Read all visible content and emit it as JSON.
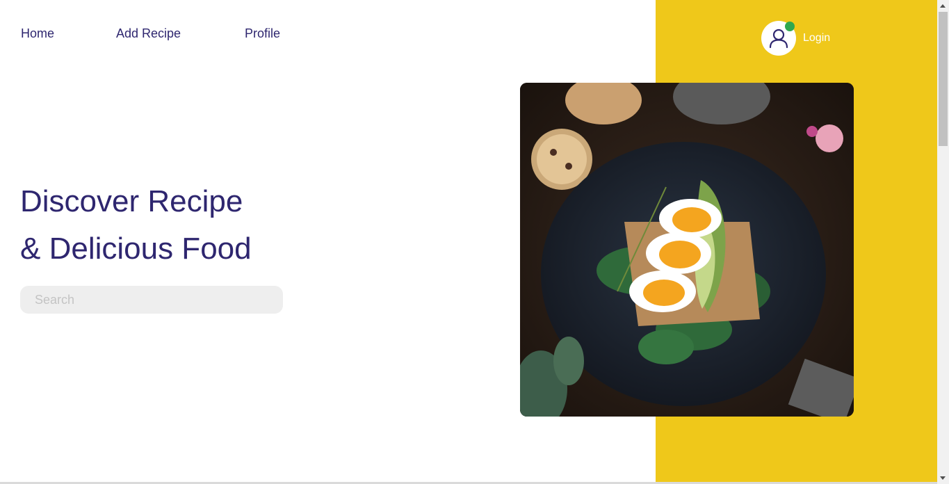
{
  "nav": {
    "items": [
      {
        "label": "Home"
      },
      {
        "label": "Add Recipe"
      },
      {
        "label": "Profile"
      }
    ]
  },
  "auth": {
    "login_label": "Login",
    "icon": "user-icon",
    "status_color": "#2FA84F"
  },
  "hero": {
    "title_line1": "Discover Recipe",
    "title_line2": "& Delicious Food"
  },
  "search": {
    "placeholder": "Search",
    "value": ""
  },
  "image": {
    "description": "egg-avocado-toast-photo"
  },
  "colors": {
    "accent": "#EFC81A",
    "primary_text": "#2E266F",
    "search_bg": "#EEEEEE"
  }
}
